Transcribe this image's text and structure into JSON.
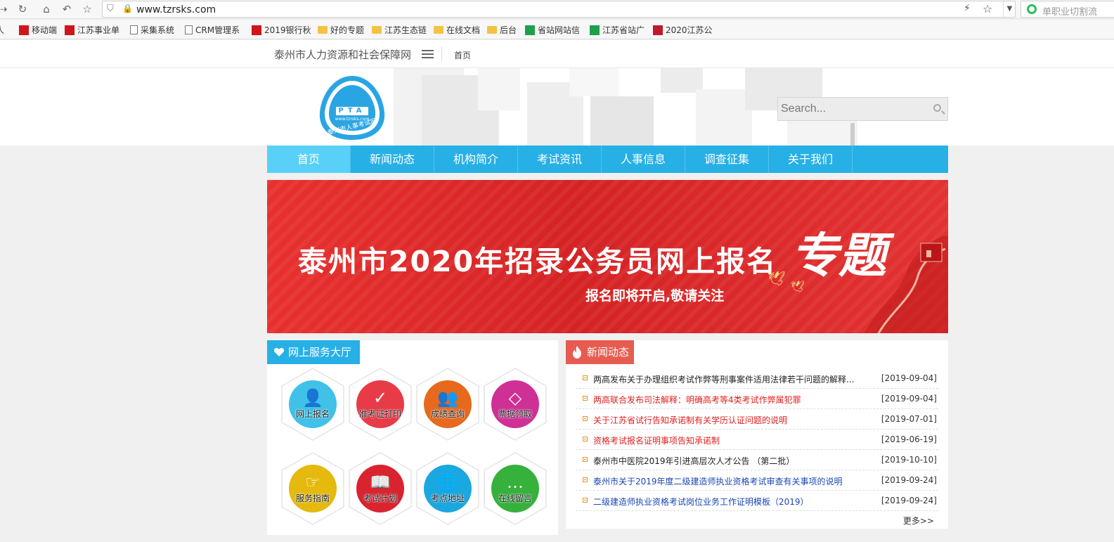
{
  "browser": {
    "url": "www.tzrsks.com",
    "search_placeholder": "单职业切割流",
    "bookmarks": [
      {
        "label": "人",
        "icon": "none"
      },
      {
        "label": "移动端",
        "icon": "red"
      },
      {
        "label": "江苏事业单",
        "icon": "red"
      },
      {
        "label": "采集系统",
        "icon": "doc"
      },
      {
        "label": "CRM管理系",
        "icon": "doc"
      },
      {
        "label": "2019银行秋",
        "icon": "red"
      },
      {
        "label": "好的专题",
        "icon": "folder"
      },
      {
        "label": "江苏生态链",
        "icon": "folder"
      },
      {
        "label": "在线文档",
        "icon": "folder"
      },
      {
        "label": "后台",
        "icon": "folder"
      },
      {
        "label": "省站网站信",
        "icon": "green"
      },
      {
        "label": "江苏省站广",
        "icon": "green"
      },
      {
        "label": "2020江苏公",
        "icon": "red2"
      }
    ]
  },
  "site": {
    "name": "泰州市人力资源和社会保障网",
    "top_home": "首页",
    "logo_text": "PTA",
    "logo_url": "www.tzrsks.com",
    "logo_name": "泰州市人事考试网",
    "search_placeholder": "Search..."
  },
  "nav": [
    {
      "label": "首页",
      "active": true
    },
    {
      "label": "新闻动态",
      "active": false
    },
    {
      "label": "机构简介",
      "active": false
    },
    {
      "label": "考试资讯",
      "active": false
    },
    {
      "label": "人事信息",
      "active": false
    },
    {
      "label": "调查征集",
      "active": false
    },
    {
      "label": "关于我们",
      "active": false
    }
  ],
  "banner": {
    "title": "泰州市2020年招录公务员网上报名",
    "script": "专题",
    "subtitle": "报名即将开启,敬请关注"
  },
  "services": {
    "title": "网上服务大厅",
    "items": [
      {
        "label": "网上报名",
        "color": "#3fc1e8",
        "glyph": "👤"
      },
      {
        "label": "准考证打印",
        "color": "#e83b48",
        "glyph": "✓"
      },
      {
        "label": "成绩查询",
        "color": "#e7691d",
        "glyph": "👥"
      },
      {
        "label": "票据领取",
        "color": "#cf3096",
        "glyph": "◇"
      },
      {
        "label": "服务指南",
        "color": "#e5b90d",
        "glyph": "☞"
      },
      {
        "label": "考试计划",
        "color": "#d92430",
        "glyph": "📖"
      },
      {
        "label": "考点地址",
        "color": "#1ba7e0",
        "glyph": "🌐"
      },
      {
        "label": "在线留言",
        "color": "#35b13c",
        "glyph": "…"
      }
    ]
  },
  "news": {
    "title": "新闻动态",
    "more": "更多>>",
    "items": [
      {
        "title": "两高发布关于办理组织考试作弊等刑事案件适用法律若干问题的解释...",
        "date": "[2019-09-04]",
        "color": "#222"
      },
      {
        "title": "两高联合发布司法解释：明确高考等4类考试作弊属犯罪",
        "date": "[2019-09-04]",
        "color": "#e0201f"
      },
      {
        "title": "关于江苏省试行告知承诺制有关学历认证问题的说明",
        "date": "[2019-07-01]",
        "color": "#e0201f"
      },
      {
        "title": "资格考试报名证明事项告知承诺制",
        "date": "[2019-06-19]",
        "color": "#e0201f"
      },
      {
        "title": "泰州市中医院2019年引进高层次人才公告 （第二批）",
        "date": "[2019-10-10]",
        "color": "#222"
      },
      {
        "title": "泰州市关于2019年度二级建造师执业资格考试审查有关事项的说明",
        "date": "[2019-09-24]",
        "color": "#1a46b6"
      },
      {
        "title": "二级建造师执业资格考试岗位业务工作证明模板（2019）",
        "date": "[2019-09-24]",
        "color": "#1a46b6"
      }
    ]
  }
}
